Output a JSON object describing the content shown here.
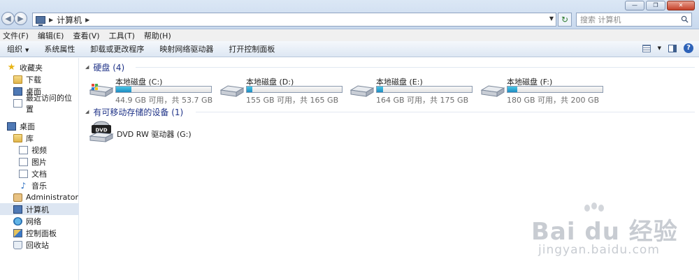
{
  "window": {
    "breadcrumb": "计算机",
    "search_placeholder": "搜索 计算机"
  },
  "menu": [
    "文件(F)",
    "编辑(E)",
    "查看(V)",
    "工具(T)",
    "帮助(H)"
  ],
  "commands": {
    "organize": "组织",
    "system_properties": "系统属性",
    "uninstall": "卸载或更改程序",
    "map_drive": "映射网络驱动器",
    "control_panel": "打开控制面板"
  },
  "sidebar": {
    "favorites": "收藏夹",
    "downloads": "下载",
    "desktop_fav": "桌面",
    "recent": "最近访问的位置",
    "desktop": "桌面",
    "libraries": "库",
    "videos": "视频",
    "pictures": "图片",
    "documents": "文档",
    "music": "音乐",
    "admin": "Administrator",
    "computer": "计算机",
    "network": "网络",
    "control_panel": "控制面板",
    "recycle_bin": "回收站"
  },
  "groups": {
    "hard_disks": "硬盘 (4)",
    "removable": "有可移动存储的设备 (1)"
  },
  "drives": [
    {
      "name": "本地磁盘 (C:)",
      "free": "44.9 GB 可用，共 53.7 GB",
      "used_fraction": 0.164
    },
    {
      "name": "本地磁盘 (D:)",
      "free": "155 GB 可用，共 165 GB",
      "used_fraction": 0.061
    },
    {
      "name": "本地磁盘 (E:)",
      "free": "164 GB 可用，共 175 GB",
      "used_fraction": 0.063
    },
    {
      "name": "本地磁盘 (F:)",
      "free": "180 GB 可用，共 200 GB",
      "used_fraction": 0.1
    }
  ],
  "dvd": {
    "name": "DVD RW 驱动器 (G:)",
    "label": "DVD"
  },
  "watermark": {
    "main": "Bai du 经验",
    "sub": "jingyan.baidu.com"
  }
}
